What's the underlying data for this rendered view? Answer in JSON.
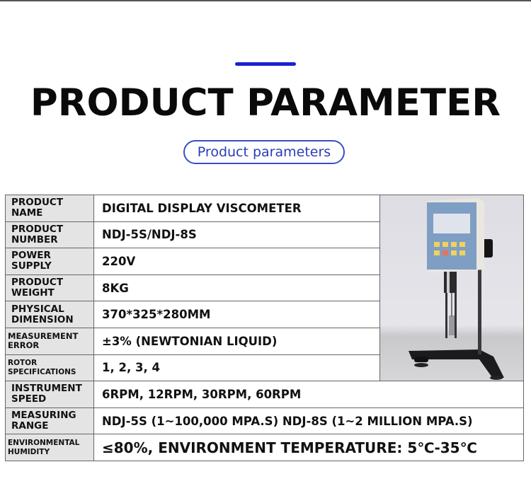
{
  "header": {
    "title": "PRODUCT PARAMETER",
    "subtitle_pill": "Product parameters",
    "accent_color": "#1a1fd6",
    "pill_color": "#2a3db8"
  },
  "table": {
    "rows": [
      {
        "label": "PRODUCT NAME",
        "value": "DIGITAL DISPLAY VISCOMETER"
      },
      {
        "label": "PRODUCT NUMBER",
        "value": "NDJ-5S/NDJ-8S"
      },
      {
        "label": "POWER SUPPLY",
        "value": "220V"
      },
      {
        "label": "PRODUCT WEIGHT",
        "value": "8KG"
      },
      {
        "label": "PHYSICAL DIMENSION",
        "value": "370*325*280MM"
      },
      {
        "label": "MEASUREMENT ERROR",
        "value": "±3% (NEWTONIAN LIQUID)"
      },
      {
        "label": "ROTOR SPECIFICATIONS",
        "value": "1, 2, 3, 4"
      },
      {
        "label": "INSTRUMENT SPEED",
        "value": "6RPM, 12RPM, 30RPM, 60RPM"
      },
      {
        "label": "MEASURING RANGE",
        "value": "NDJ-5S (1~100,000 MPA.S) NDJ-8S (1~2 MILLION MPA.S)"
      },
      {
        "label": "ENVIRONMENTAL HUMIDITY",
        "value": "≤80%, ENVIRONMENT TEMPERATURE: 5℃-35℃"
      }
    ],
    "product_image": "digital-viscometer-photo"
  }
}
